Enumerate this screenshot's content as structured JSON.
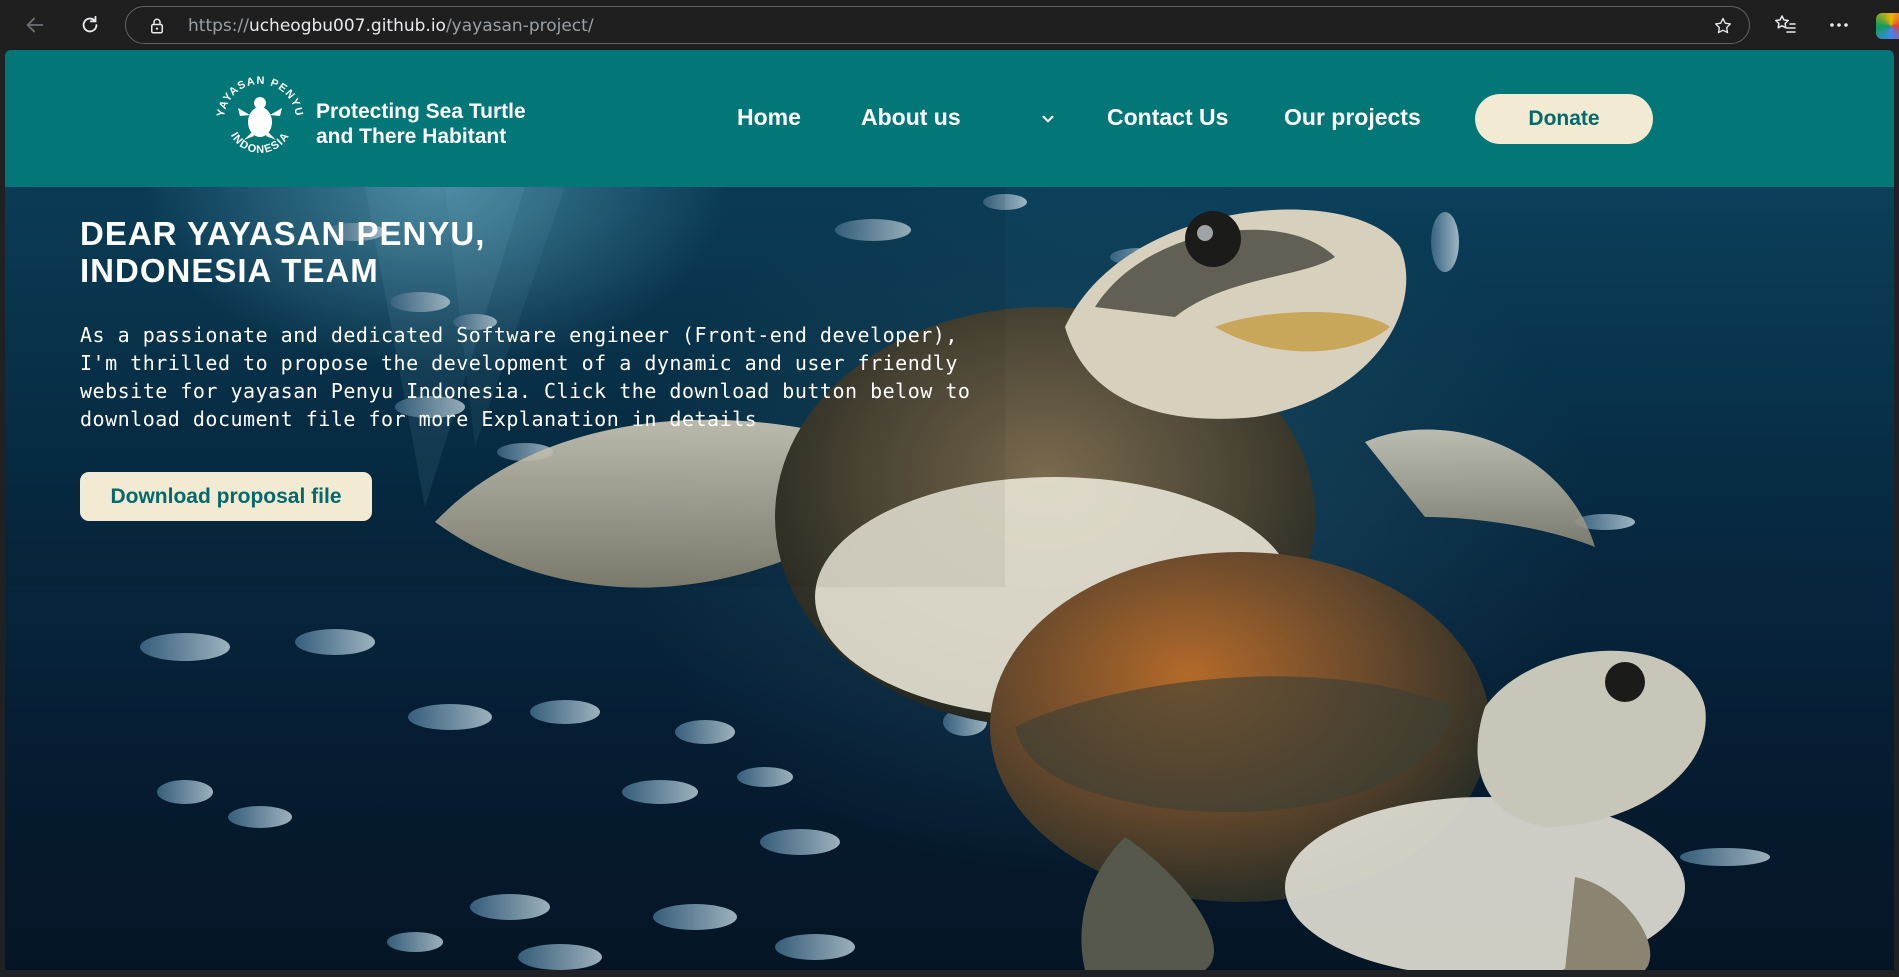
{
  "browser": {
    "url_prefix": "https://",
    "url_host": "ucheogbu007.github.io",
    "url_path": "/yayasan-project/"
  },
  "header": {
    "logo_text_top": "YAYASAN PENYU",
    "logo_text_bottom": "INDONESIA",
    "brand_line1": "Protecting Sea Turtle",
    "brand_line2": "and There Habitant",
    "nav": {
      "home": "Home",
      "about": "About us",
      "contact": "Contact Us",
      "projects": "Our projects"
    },
    "donate_label": "Donate"
  },
  "hero": {
    "title_line1": "DEAR YAYASAN PENYU,",
    "title_line2": "INDONESIA TEAM",
    "body": "As a passionate and dedicated Software engineer (Front-end developer), I'm thrilled to propose the development of a dynamic and user friendly website for yayasan Penyu Indonesia. Click the download button below to download document file for more Explanation in details",
    "download_label": "Download proposal file"
  },
  "colors": {
    "header_bg": "#037678",
    "button_bg": "#f2ead2",
    "button_text": "#036a6c"
  }
}
